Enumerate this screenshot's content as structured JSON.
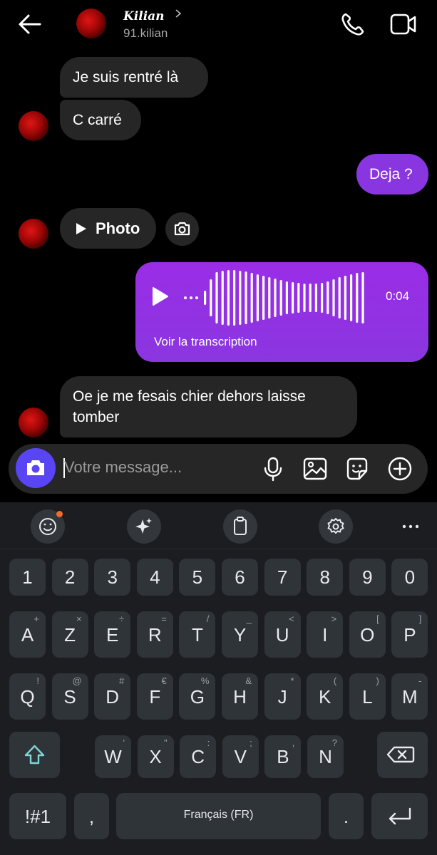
{
  "header": {
    "display_name": "Kilian",
    "username": "91.kilian",
    "back_icon": "arrow-left-icon",
    "call_icon": "phone-icon",
    "video_icon": "video-camera-icon"
  },
  "messages": [
    {
      "from": "them",
      "text": "Je suis rentré là"
    },
    {
      "from": "them",
      "text": "C carré"
    },
    {
      "from": "me",
      "text": "Deja ?"
    },
    {
      "from": "them",
      "type": "photo",
      "text": "Photo"
    },
    {
      "from": "me",
      "type": "voice",
      "duration": "0:04",
      "transcript_link": "Voir la transcription"
    },
    {
      "from": "them",
      "text": "Oe je me fesais chier dehors laisse tomber"
    }
  ],
  "composer": {
    "placeholder": "Votre message..."
  },
  "keyboard": {
    "toolbar": [
      "emoji-icon",
      "sparkle-icon",
      "clipboard-icon",
      "settings-icon",
      "more-icon"
    ],
    "row_numbers": [
      "1",
      "2",
      "3",
      "4",
      "5",
      "6",
      "7",
      "8",
      "9",
      "0"
    ],
    "row1": [
      {
        "k": "A",
        "s": "+"
      },
      {
        "k": "Z",
        "s": "×"
      },
      {
        "k": "E",
        "s": "÷"
      },
      {
        "k": "R",
        "s": "="
      },
      {
        "k": "T",
        "s": "/"
      },
      {
        "k": "Y",
        "s": "_"
      },
      {
        "k": "U",
        "s": "<"
      },
      {
        "k": "I",
        "s": ">"
      },
      {
        "k": "O",
        "s": "["
      },
      {
        "k": "P",
        "s": "]"
      }
    ],
    "row2": [
      {
        "k": "Q",
        "s": "!"
      },
      {
        "k": "S",
        "s": "@"
      },
      {
        "k": "D",
        "s": "#"
      },
      {
        "k": "F",
        "s": "€"
      },
      {
        "k": "G",
        "s": "%"
      },
      {
        "k": "H",
        "s": "&"
      },
      {
        "k": "J",
        "s": "*"
      },
      {
        "k": "K",
        "s": "("
      },
      {
        "k": "L",
        "s": ")"
      },
      {
        "k": "M",
        "s": "-"
      }
    ],
    "row3": [
      {
        "k": "W",
        "s": "'"
      },
      {
        "k": "X",
        "s": "\""
      },
      {
        "k": "C",
        "s": ":"
      },
      {
        "k": "V",
        "s": ";"
      },
      {
        "k": "B",
        "s": ","
      },
      {
        "k": "N",
        "s": "?"
      }
    ],
    "symbols_key": "!#1",
    "comma_key": ",",
    "space_label": "Français (FR)",
    "period_key": "."
  },
  "colors": {
    "background": "#000000",
    "bubble_received": "#262626",
    "bubble_sent": "#8a36e0",
    "camera_button": "#5a45f5",
    "keyboard_bg": "#1b1d20",
    "key_bg": "#2f3438",
    "shift_accent": "#7fd6d6"
  }
}
